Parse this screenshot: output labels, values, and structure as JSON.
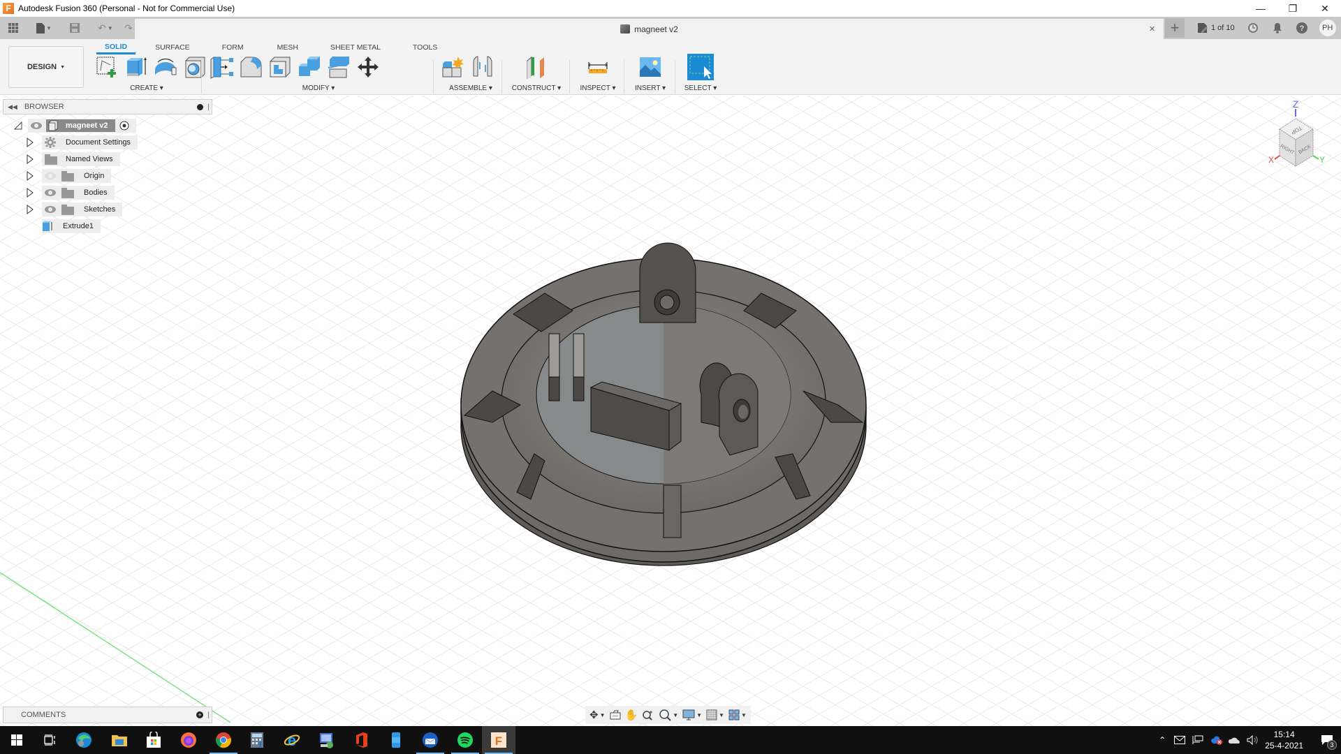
{
  "window": {
    "title": "Autodesk Fusion 360 (Personal - Not for Commercial Use)",
    "app_icon_letter": "F",
    "controls": [
      "minimize-icon",
      "restore-icon",
      "close-icon"
    ]
  },
  "quick_access": {
    "items": [
      "apps-grid-icon",
      "file-icon",
      "save-icon",
      "undo-icon",
      "redo-icon"
    ]
  },
  "document_tab": {
    "title": "magneet v2",
    "close": "×"
  },
  "tab_right": {
    "new_tab": "+",
    "jobs_status": "1 of 10",
    "avatar_initials": "PH"
  },
  "ribbon": {
    "workspace_label": "DESIGN",
    "tabs": [
      {
        "label": "SOLID",
        "active": true
      },
      {
        "label": "SURFACE",
        "active": false
      },
      {
        "label": "FORM",
        "active": false
      },
      {
        "label": "MESH",
        "active": false
      },
      {
        "label": "SHEET METAL",
        "active": false
      },
      {
        "label": "TOOLS",
        "active": false
      }
    ],
    "groups": {
      "create": {
        "label": "CREATE ▾",
        "tools": [
          "create-sketch-icon",
          "extrude-icon",
          "revolve-icon",
          "hole-icon",
          "pattern-icon"
        ]
      },
      "modify": {
        "label": "MODIFY ▾",
        "tools": [
          "press-pull-icon",
          "fillet-icon",
          "shell-icon",
          "combine-icon",
          "split-face-icon",
          "move-icon"
        ]
      },
      "assemble": {
        "label": "ASSEMBLE ▾",
        "tools": [
          "new-component-icon",
          "joint-icon"
        ]
      },
      "construct": {
        "label": "CONSTRUCT ▾",
        "tools": [
          "offset-plane-icon"
        ]
      },
      "inspect": {
        "label": "INSPECT ▾",
        "tools": [
          "measure-icon"
        ]
      },
      "insert": {
        "label": "INSERT ▾",
        "tools": [
          "insert-image-icon"
        ]
      },
      "select": {
        "label": "SELECT ▾",
        "tools": [
          "select-icon"
        ]
      }
    }
  },
  "browser": {
    "header": "BROWSER",
    "root": "magneet v2",
    "items": [
      {
        "label": "Document Settings",
        "icon": "gear-icon",
        "eye": false
      },
      {
        "label": "Named Views",
        "icon": "folder-icon",
        "eye": false
      },
      {
        "label": "Origin",
        "icon": "folder-icon",
        "eye": "hidden"
      },
      {
        "label": "Bodies",
        "icon": "folder-icon",
        "eye": "visible"
      },
      {
        "label": "Sketches",
        "icon": "folder-icon",
        "eye": "visible"
      },
      {
        "label": "Extrude1",
        "icon": "extrude-icon",
        "eye": false
      }
    ]
  },
  "comments": {
    "header": "COMMENTS"
  },
  "viewcube": {
    "axis_z": "Z",
    "axis_x": "X",
    "axis_y": "Y",
    "face_top": "TOP",
    "face_right": "RIGHT",
    "face_back": "BACK"
  },
  "nav_bar": {
    "items": [
      "orbit-icon",
      "look-at-icon",
      "pan-icon",
      "zoom-icon",
      "fit-icon",
      "display-settings-icon",
      "grid-settings-icon",
      "viewports-icon"
    ]
  },
  "taskbar": {
    "apps": [
      "windows-start-icon",
      "task-view-icon",
      "edge-icon",
      "file-explorer-icon",
      "store-icon",
      "firefox-icon",
      "chrome-icon",
      "calculator-icon",
      "internet-explorer-icon",
      "remote-desktop-icon",
      "office-icon",
      "phone-icon",
      "thunderbird-icon",
      "spotify-icon",
      "fusion360-icon"
    ],
    "time": "15:14",
    "date": "25-4-2021",
    "notification_count": "3"
  },
  "colors": {
    "accent": "#1c8bd6",
    "ribbon_bg": "#f3f3f3",
    "tabbar_bg": "#c9c9c9",
    "model_body": "#6e6a66",
    "taskbar_bg": "#101010"
  }
}
